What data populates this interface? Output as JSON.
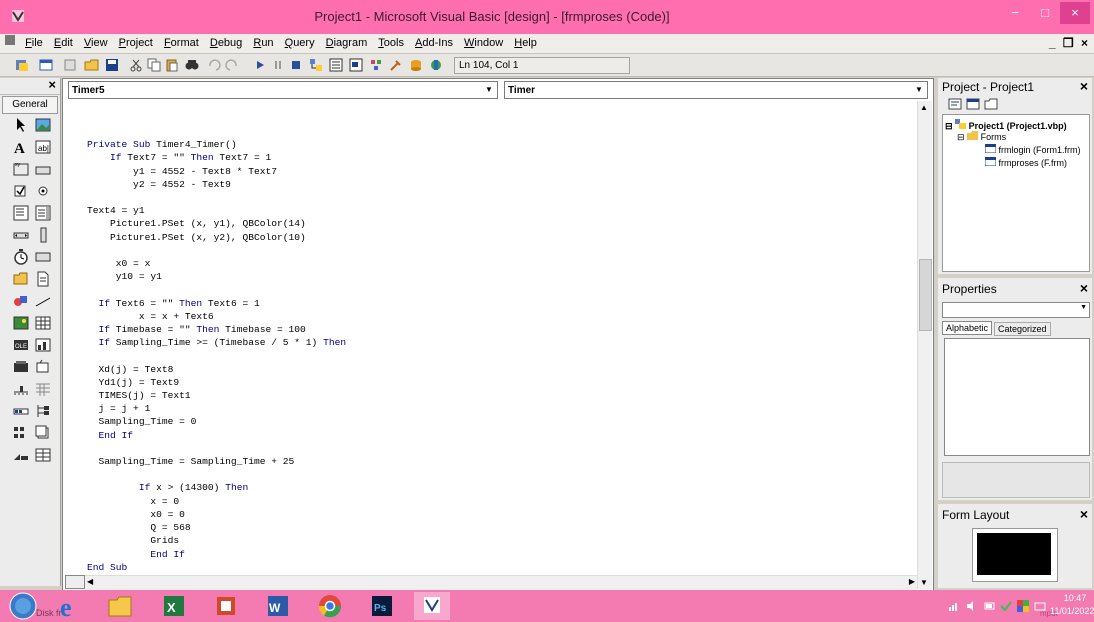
{
  "window": {
    "title": "Project1 - Microsoft Visual Basic [design] - [frmproses (Code)]",
    "minimize": "−",
    "maximize": "□",
    "close": "×"
  },
  "menu": {
    "items": [
      "File",
      "Edit",
      "View",
      "Project",
      "Format",
      "Debug",
      "Run",
      "Query",
      "Diagram",
      "Tools",
      "Add-Ins",
      "Window",
      "Help"
    ],
    "mdi_controls": "_ ❒ ×"
  },
  "toolbar": {
    "position": "Ln 104, Col 1"
  },
  "toolbox": {
    "close": "×",
    "tab": "General"
  },
  "code_window": {
    "object_combo": "Timer5",
    "procedure_combo": "Timer",
    "lines": [
      "",
      "Private Sub Timer4_Timer()",
      "    If Text7 = \"\" Then Text7 = 1",
      "        y1 = 4552 - Text8 * Text7",
      "        y2 = 4552 - Text9",
      "",
      "Text4 = y1",
      "    Picture1.PSet (x, y1), QBColor(14)",
      "    Picture1.PSet (x, y2), QBColor(10)",
      "",
      "     x0 = x",
      "     y10 = y1",
      "",
      "  If Text6 = \"\" Then Text6 = 1",
      "         x = x + Text6",
      "  If Timebase = \"\" Then Timebase = 100",
      "  If Sampling_Time >= (Timebase / 5 * 1) Then",
      "",
      "  Xd(j) = Text8",
      "  Yd1(j) = Text9",
      "  TIMES(j) = Text1",
      "  j = j + 1",
      "  Sampling_Time = 0",
      "  End If",
      "",
      "  Sampling_Time = Sampling_Time + 25",
      "",
      "         If x > (14300) Then",
      "           x = 0",
      "           x0 = 0",
      "           Q = 568",
      "           Grids",
      "           End If",
      "End Sub"
    ]
  },
  "project_panel": {
    "title": "Project - Project1",
    "close": "×",
    "tree": {
      "root": "Project1 (Project1.vbp)",
      "folder": "Forms",
      "items": [
        "frmlogin (Form1.frm)",
        "frmproses (F.frm)"
      ]
    }
  },
  "properties_panel": {
    "title": "Properties",
    "close": "×",
    "tabs": [
      "Alphabetic",
      "Categorized"
    ]
  },
  "form_layout_panel": {
    "title": "Form Layout",
    "close": "×"
  },
  "taskbar": {
    "left_label": "Disk fr",
    "time": "10:47",
    "date": "11/01/2022",
    "tray_label": "mput"
  },
  "colors": {
    "titlebar": "#ff6fb0",
    "taskbar": "#f37bb1",
    "keyword": "#00008b"
  }
}
